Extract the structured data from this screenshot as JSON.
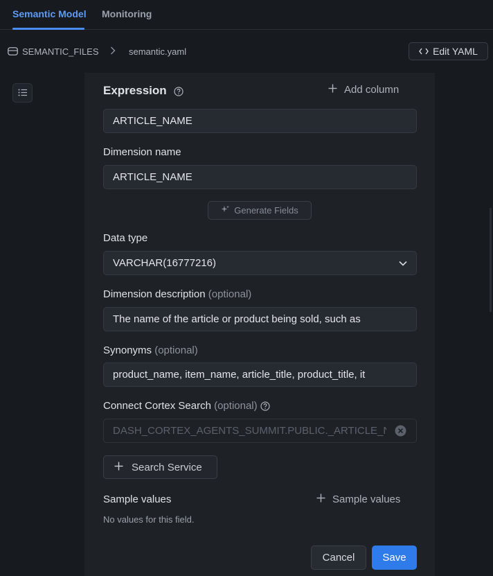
{
  "tabs": [
    {
      "label": "Semantic Model",
      "active": true
    },
    {
      "label": "Monitoring",
      "active": false
    }
  ],
  "breadcrumb": {
    "root": "SEMANTIC_FILES",
    "file": "semantic.yaml",
    "root_icon": "database-icon",
    "separator_icon": "chevron-right-icon"
  },
  "toolbar": {
    "edit_yaml_label": "Edit YAML",
    "edit_yaml_icon": "code-icon"
  },
  "form": {
    "expression": {
      "label": "Expression",
      "value": "ARTICLE_NAME",
      "add_column_label": "Add column"
    },
    "dimension_name": {
      "label": "Dimension name",
      "value": "ARTICLE_NAME"
    },
    "generate_fields_label": "Generate Fields",
    "data_type": {
      "label": "Data type",
      "value": "VARCHAR(16777216)"
    },
    "description": {
      "label": "Dimension description",
      "optional": "(optional)",
      "value": "The name of the article or product being sold, such as"
    },
    "synonyms": {
      "label": "Synonyms",
      "optional": "(optional)",
      "value": "product_name, item_name, article_title, product_title, it"
    },
    "cortex_search": {
      "label": "Connect Cortex Search",
      "optional": "(optional)",
      "value": "DASH_CORTEX_AGENTS_SUMMIT.PUBLIC._ARTICLE_NAME"
    },
    "search_service_label": "Search Service",
    "sample_values": {
      "label": "Sample values",
      "add_label": "Sample values",
      "empty_text": "No values for this field."
    },
    "cancel_label": "Cancel",
    "save_label": "Save"
  },
  "colors": {
    "accent": "#2f7bea",
    "active_tab": "#5b9cf6",
    "background": "#171a1f",
    "panel": "#1e2126"
  }
}
